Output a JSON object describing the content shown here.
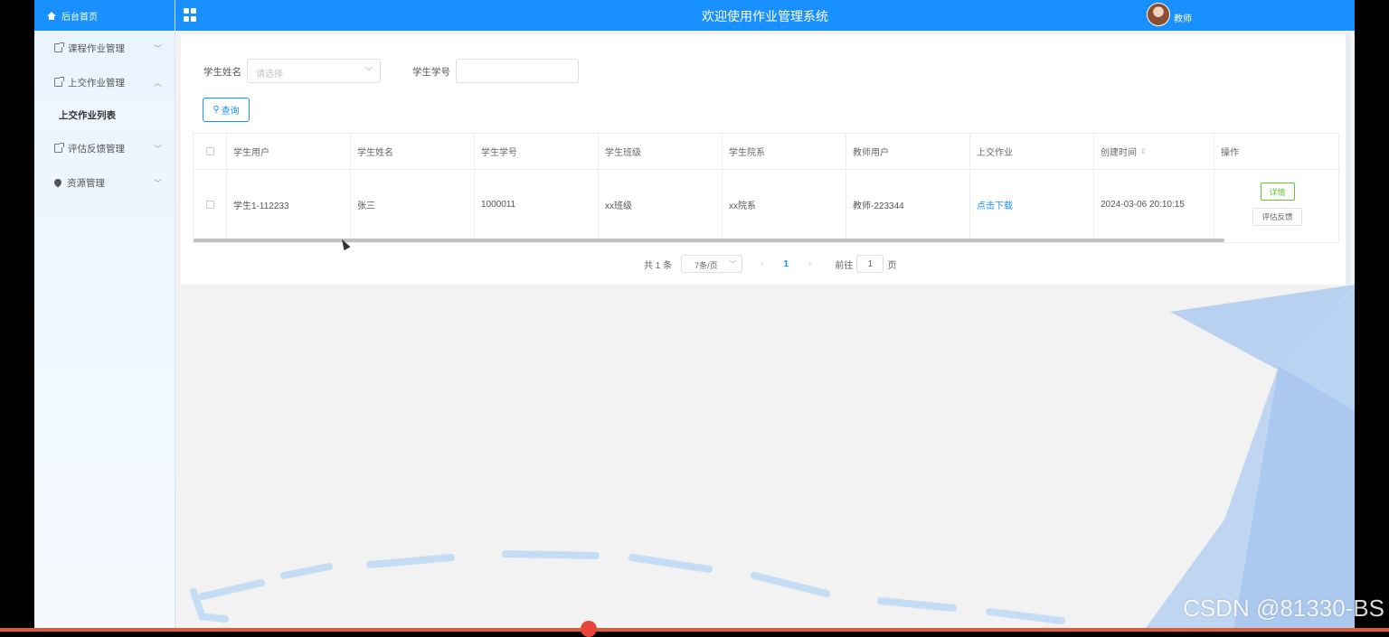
{
  "sidebar": {
    "home_label": "后台首页",
    "items": [
      {
        "label": "课程作业管理",
        "expanded": false
      },
      {
        "label": "上交作业管理",
        "expanded": true
      },
      {
        "label": "评估反馈管理",
        "expanded": false
      },
      {
        "label": "资源管理",
        "expanded": false
      }
    ],
    "sub_item": "上交作业列表"
  },
  "topbar": {
    "title": "欢迎使用作业管理系统",
    "user": "教师"
  },
  "filters": {
    "name_label": "学生姓名",
    "name_placeholder": "请选择",
    "id_label": "学生学号",
    "query_label": "查询"
  },
  "table": {
    "columns": [
      "学生用户",
      "学生姓名",
      "学生学号",
      "学生班级",
      "学生院系",
      "教师用户",
      "上交作业",
      "创建时间",
      "操作"
    ],
    "rows": [
      {
        "student_user": "学生1-112233",
        "student_name": "张三",
        "student_id": "1000011",
        "student_class": "xx班级",
        "student_dept": "xx院系",
        "teacher_user": "教师-223344",
        "homework": "点击下载",
        "created": "2024-03-06 20:10:15",
        "btn_detail": "详情",
        "btn_eval": "评估反馈"
      }
    ]
  },
  "pagination": {
    "total": "共 1 条",
    "page_size": "7条/页",
    "current": "1",
    "goto_label": "前往",
    "goto_value": "1",
    "page_suffix": "页"
  },
  "watermark": "CSDN @81330-BS",
  "colors": {
    "primary": "#1890ff",
    "success": "#67c23a",
    "sidebar_bg": "#e9f4ff"
  }
}
